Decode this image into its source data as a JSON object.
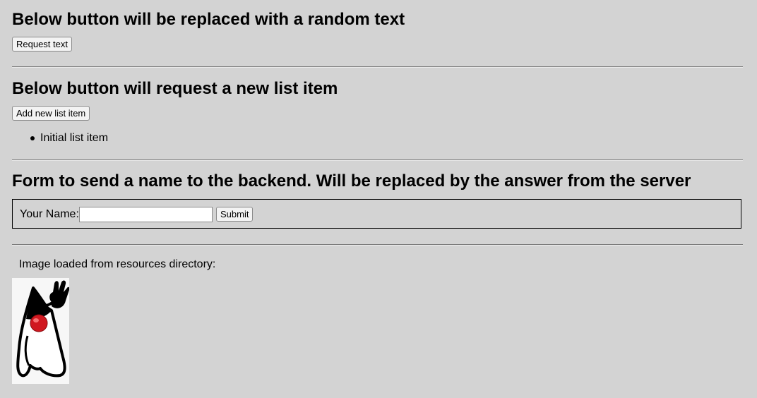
{
  "sections": {
    "random_text": {
      "heading": "Below button will be replaced with a random text",
      "button_label": "Request text"
    },
    "list_request": {
      "heading": "Below button will request a new list item",
      "button_label": "Add new list item",
      "items": [
        "Initial list item"
      ]
    },
    "name_form": {
      "heading": "Form to send a name to the backend. Will be replaced by the answer from the server",
      "label": "Your Name:",
      "input_value": "",
      "submit_label": "Submit"
    },
    "image": {
      "caption": "Image loaded from resources directory:",
      "icon": "duke-mascot"
    }
  },
  "colors": {
    "background": "#d3d3d3",
    "divider": "#7a7a7a",
    "mascot_nose": "#e8202a"
  }
}
